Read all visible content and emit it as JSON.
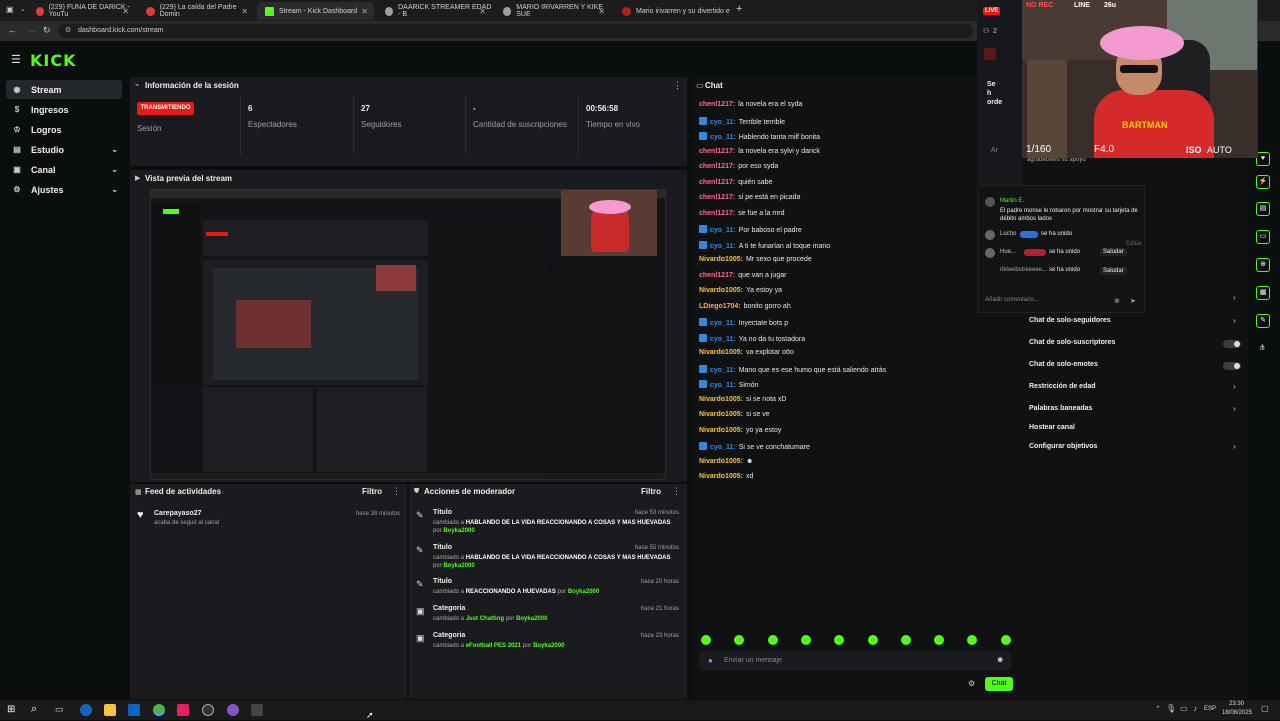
{
  "browser": {
    "tabs": [
      {
        "label": "(229) FUNA DE DARICK - YouTu",
        "color": "#e53935"
      },
      {
        "label": "(229) La caída del Padre Domin",
        "color": "#e53935"
      },
      {
        "label": "Stream - Kick Dashboard",
        "color": "#53fc18"
      },
      {
        "label": "DAARICK STREAMER EDAD - B",
        "color": "#9e9e9e"
      },
      {
        "label": "MARIO IRIVARREN Y KIKE SUE",
        "color": "#9e9e9e"
      },
      {
        "label": "Mario irivarren y su divertido e",
        "color": "#b71c1c"
      }
    ],
    "new_tab": "+",
    "url": "dashboard.kick.com/stream"
  },
  "brand": {
    "logo": "KICK",
    "accent": "#53fc18"
  },
  "sidebar": {
    "items": [
      {
        "label": "Stream",
        "icon": "broadcast-icon"
      },
      {
        "label": "Ingresos",
        "icon": "money-icon"
      },
      {
        "label": "Logros",
        "icon": "trophy-icon"
      },
      {
        "label": "Estudio",
        "icon": "studio-icon"
      },
      {
        "label": "Canal",
        "icon": "channel-icon"
      },
      {
        "label": "Ajustes",
        "icon": "gear-icon"
      }
    ]
  },
  "session": {
    "title": "Información de la sesión",
    "status_badge": "TRANSMITIENDO",
    "status_label": "Sesión",
    "viewers_value": "6",
    "viewers_label": "Espectadores",
    "followers_value": "27",
    "followers_label": "Seguidores",
    "subs_value": "-",
    "subs_label": "Cantidad de suscripciones",
    "live_time_value": "00:56:58",
    "live_time_label": "Tiempo en vivo"
  },
  "preview": {
    "title": "Vista previa del stream"
  },
  "activity": {
    "title": "Feed de actividades",
    "filter": "Filtro",
    "items": [
      {
        "user": "Carepayaso27",
        "text": "acaba de seguir al canal",
        "time": "hace 38 minutos"
      }
    ]
  },
  "modactions": {
    "title": "Acciones de moderador",
    "filter": "Filtro",
    "items": [
      {
        "type": "Título",
        "prefix": "cambiado a",
        "value": "HABLANDO DE LA VIDA REACCIONANDO A COSAS Y MAS HUEVADAS",
        "by_prefix": "por",
        "by": "Boyka2000",
        "time": "hace 53 minutos"
      },
      {
        "type": "Título",
        "prefix": "cambiado a",
        "value": "HABLANDO DE LA VIDA REACCIONANDO A COSAS Y MAS HUEVADAS",
        "by_prefix": "por",
        "by": "Boyka2000",
        "time": "hace 55 minutos"
      },
      {
        "type": "Título",
        "prefix": "cambiado a",
        "value": "REACCIONANDO A HUEVADAS",
        "by_prefix": "por",
        "by": "Boyka2000",
        "time": "hace 20 horas"
      },
      {
        "type": "Categoria",
        "prefix": "cambiado a",
        "value": "Just Chatting",
        "by_prefix": "por",
        "by": "Boyka2000",
        "time": "hace 21 horas"
      },
      {
        "type": "Categoria",
        "prefix": "cambiado a",
        "value": "eFootball PES 2021",
        "by_prefix": "por",
        "by": "Boyka2000",
        "time": "hace 23 horas"
      }
    ]
  },
  "chat": {
    "title": "Chat",
    "messages": [
      {
        "user": "chenl1217:",
        "color": "#ff6b8a",
        "badge": false,
        "text": "la novela era el syda"
      },
      {
        "user": "cyo_11:",
        "color": "#2f8ae0",
        "badge": true,
        "text": "Terrible terrible"
      },
      {
        "user": "cyo_11:",
        "color": "#2f8ae0",
        "badge": true,
        "text": "Hablendo tanta milf bonita"
      },
      {
        "user": "chenl1217:",
        "color": "#ff6b8a",
        "badge": false,
        "text": "la novela era sylvi y darick"
      },
      {
        "user": "chenl1217:",
        "color": "#ff6b8a",
        "badge": false,
        "text": "por eso syda"
      },
      {
        "user": "chenl1217:",
        "color": "#ff6b8a",
        "badge": false,
        "text": "quién sabe"
      },
      {
        "user": "chenl1217:",
        "color": "#ff6b8a",
        "badge": false,
        "text": "si pe está en picada"
      },
      {
        "user": "chenl1217:",
        "color": "#ff6b8a",
        "badge": false,
        "text": "se fue a la mrd"
      },
      {
        "user": "cyo_11:",
        "color": "#2f8ae0",
        "badge": true,
        "text": "Por baboso el padre"
      },
      {
        "user": "cyo_11:",
        "color": "#2f8ae0",
        "badge": true,
        "text": "A ti te funarían al toque mano"
      },
      {
        "user": "Nivardo1005:",
        "color": "#f5c542",
        "badge": false,
        "text": "Mr sexo que procede"
      },
      {
        "user": "chenl1217:",
        "color": "#ff6b8a",
        "badge": false,
        "text": "que van a jugar"
      },
      {
        "user": "Nivardo1005:",
        "color": "#f5c542",
        "badge": false,
        "text": "Ya estoy ya"
      },
      {
        "user": "LDiego1704:",
        "color": "#ffa94d",
        "badge": false,
        "text": "bonito gorro ah"
      },
      {
        "user": "cyo_11:",
        "color": "#2f8ae0",
        "badge": true,
        "text": "Inyectate bots p"
      },
      {
        "user": "cyo_11:",
        "color": "#2f8ae0",
        "badge": true,
        "text": "Ya no da tu tostadora"
      },
      {
        "user": "Nivardo1005:",
        "color": "#f5c542",
        "badge": false,
        "text": "va explotar otto"
      },
      {
        "user": "cyo_11:",
        "color": "#2f8ae0",
        "badge": true,
        "text": "Mano que es ese humo que está saliendo atrás"
      },
      {
        "user": "cyo_11:",
        "color": "#2f8ae0",
        "badge": true,
        "text": "Simón"
      },
      {
        "user": "Nivardo1005:",
        "color": "#f5c542",
        "badge": false,
        "text": "si se nota xD"
      },
      {
        "user": "Nivardo1005:",
        "color": "#f5c542",
        "badge": false,
        "text": "si se ve"
      },
      {
        "user": "Nivardo1005:",
        "color": "#f5c542",
        "badge": false,
        "text": "yo ya estoy"
      },
      {
        "user": "cyo_11:",
        "color": "#2f8ae0",
        "badge": true,
        "text": "Si se ve conchatumare"
      },
      {
        "user": "Nivardo1005:",
        "color": "#f5c542",
        "badge": false,
        "text": "☻"
      },
      {
        "user": "Nivardo1005:",
        "color": "#f5c542",
        "badge": false,
        "text": "xd"
      }
    ],
    "input_placeholder": "Enviar un mensaje",
    "send_label": "Chat"
  },
  "settings": {
    "items": [
      {
        "label": "Chat de solo-seguidores",
        "control": "chevron"
      },
      {
        "label": "Chat de solo-suscriptores",
        "control": "toggle"
      },
      {
        "label": "Chat de solo-emotes",
        "control": "toggle"
      },
      {
        "label": "Restricción de edad",
        "control": "chevron"
      },
      {
        "label": "Palabras baneadas",
        "control": "chevron"
      },
      {
        "label": "Hostear canal",
        "control": "none"
      },
      {
        "label": "Configurar objetivos",
        "control": "chevron"
      }
    ]
  },
  "overlay": {
    "comment_user": "Martin E.",
    "comment_text": "El padre monse le robaron por mostrar su tarjeta de débito ambos lados",
    "joins": [
      {
        "user": "Lucho",
        "text": "se ha unido"
      },
      {
        "user": "Hue...",
        "text": "se ha unido",
        "action": "Saludar"
      },
      {
        "user": "rikiwebstreeeee...",
        "text": "se ha unido",
        "action": "Saludar"
      }
    ],
    "comment_placeholder": "Añadir comentario...",
    "edit_label": "Editar",
    "top_count": "2",
    "top_partial": "Se h orde",
    "mid_partial": "Ar",
    "sub_partial": "agradeceles su apoyo"
  },
  "webcam": {
    "live_badge": "LIVE",
    "stats": "1/160",
    "fstop": "F4.0",
    "iso": "ISO",
    "mode": "AUTO",
    "top_left": "NO REC",
    "line_label": "LINE",
    "line_val": "26u",
    "shirt_text": "BARTMAN"
  },
  "taskbar": {
    "lang": "ESP",
    "time": "23:30",
    "date": "18/08/2025"
  }
}
